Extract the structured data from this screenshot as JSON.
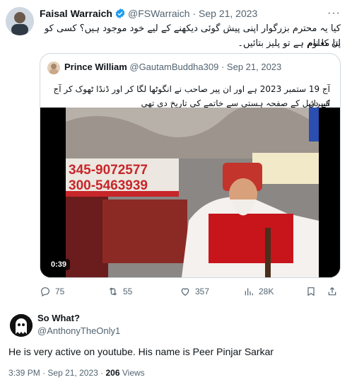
{
  "tweet": {
    "author_name": "Faisal Warraich",
    "author_handle": "@FSWarraich",
    "separator": "·",
    "date": "Sep 21, 2023",
    "more_label": "···",
    "text_line1": "کیا یہ محترم بزرگوار اپنی پیش گوئی دیکھنے کے لیے خود موجود ہیں؟ کسی کو ان کا نام",
    "text_line2": "پتا معلوم ہے تو پلیز بتائیں۔",
    "colors": {
      "verified": "#1d9bf0",
      "muted": "#536471"
    }
  },
  "quote": {
    "author_name": "Prince William",
    "author_handle": "@GautamBuddha309",
    "separator": "·",
    "date": "Sep 21, 2023",
    "text_line1": "آج 19 ستمبر 2023 ہے اور ان پیر صاحب نے انگوٹھا لگا کر اور ڈنڈا ٹھوک کر آج کے دن",
    "text_line2": "اسرائیل کے صفحہ ہستی سے خاتمے کی تاریخ دی تھی",
    "video": {
      "duration": "0:39",
      "banner_line1": "345-9072577",
      "banner_line2": "300-5463939"
    }
  },
  "actions": {
    "replies": "75",
    "reposts": "55",
    "likes": "357",
    "views": "28K",
    "icons": [
      "reply-icon",
      "repost-icon",
      "like-icon",
      "views-icon",
      "bookmark-icon",
      "share-icon"
    ]
  },
  "reply": {
    "author_name": "So What?",
    "author_handle": "@AnthonyTheOnly1",
    "text": "He is very active on youtube. His name is Peer Pinjar Sarkar",
    "time": "3:39 PM",
    "separator": "·",
    "date": "Sep 21, 2023",
    "separator2": "·",
    "views_count": "206",
    "views_label": "Views"
  }
}
